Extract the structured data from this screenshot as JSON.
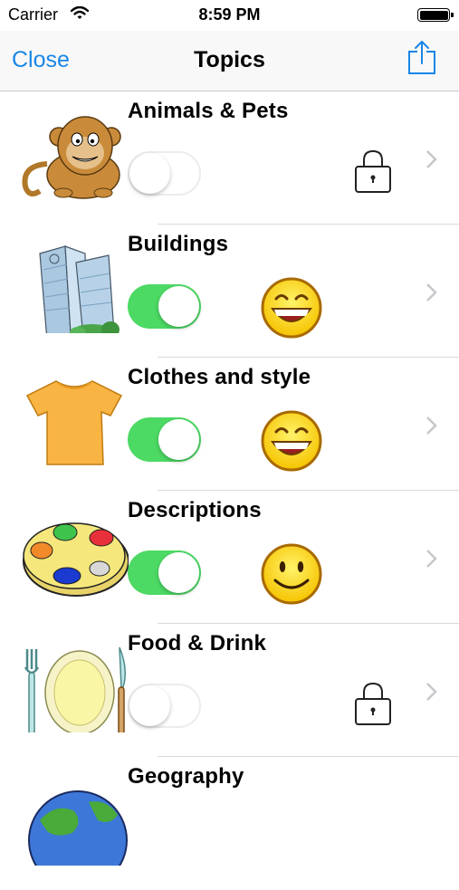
{
  "status_bar": {
    "carrier": "Carrier",
    "time": "8:59 PM"
  },
  "nav": {
    "close_label": "Close",
    "title": "Topics",
    "share_icon": "share-icon"
  },
  "colors": {
    "tint": "#1a86e6",
    "switch_on": "#4cd964"
  },
  "topics": [
    {
      "label": "Animals & Pets",
      "enabled": false,
      "status": "locked",
      "icon": "monkey"
    },
    {
      "label": "Buildings",
      "enabled": true,
      "status": "laughing-face",
      "icon": "buildings"
    },
    {
      "label": "Clothes and style",
      "enabled": true,
      "status": "laughing-face",
      "icon": "t-shirt"
    },
    {
      "label": "Descriptions",
      "enabled": true,
      "status": "smiling-face",
      "icon": "paint-palette"
    },
    {
      "label": "Food & Drink",
      "enabled": false,
      "status": "locked",
      "icon": "plate-fork-knife"
    },
    {
      "label": "Geography",
      "enabled": null,
      "status": null,
      "icon": "globe"
    }
  ]
}
